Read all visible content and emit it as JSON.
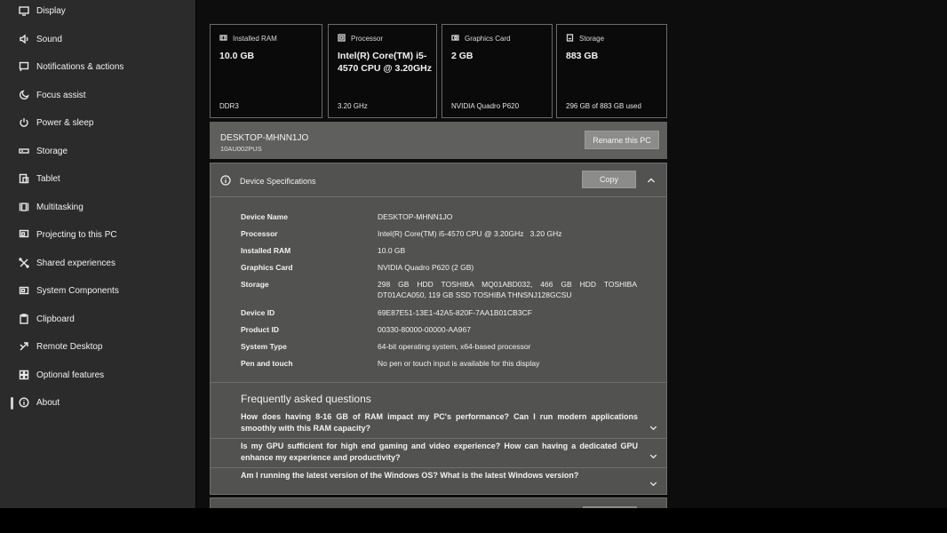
{
  "sidebar": {
    "items": [
      {
        "label": "Display",
        "icon": "monitor-icon"
      },
      {
        "label": "Sound",
        "icon": "speaker-icon"
      },
      {
        "label": "Notifications & actions",
        "icon": "notification-icon"
      },
      {
        "label": "Focus assist",
        "icon": "moon-icon"
      },
      {
        "label": "Power & sleep",
        "icon": "power-icon"
      },
      {
        "label": "Storage",
        "icon": "storage-icon"
      },
      {
        "label": "Tablet",
        "icon": "tablet-icon"
      },
      {
        "label": "Multitasking",
        "icon": "multitasking-icon"
      },
      {
        "label": "Projecting to this PC",
        "icon": "projecting-icon"
      },
      {
        "label": "Shared experiences",
        "icon": "shared-experiences-icon"
      },
      {
        "label": "System Components",
        "icon": "system-components-icon"
      },
      {
        "label": "Clipboard",
        "icon": "clipboard-icon"
      },
      {
        "label": "Remote Desktop",
        "icon": "remote-desktop-icon"
      },
      {
        "label": "Optional features",
        "icon": "optional-features-icon"
      },
      {
        "label": "About",
        "icon": "info-icon"
      }
    ],
    "active": "About"
  },
  "cards": [
    {
      "title": "Installed RAM",
      "value": "10.0 GB",
      "sub": "DDR3",
      "icon": "ram-icon"
    },
    {
      "title": "Processor",
      "value": "Intel(R) Core(TM) i5-4570 CPU @ 3.20GHz",
      "sub": "3.20 GHz",
      "icon": "processor-icon"
    },
    {
      "title": "Graphics Card",
      "value": "2 GB",
      "sub": "NVIDIA Quadro P620",
      "icon": "graphics-card-icon"
    },
    {
      "title": "Storage",
      "value": "883 GB",
      "sub": "296 GB of 883 GB used",
      "icon": "storage-icon"
    }
  ],
  "device": {
    "name": "DESKTOP-MHNN1JO",
    "model": "10AU002PUS",
    "rename_label": "Rename this PC"
  },
  "specs": {
    "title": "Device Specifications",
    "copy_label": "Copy",
    "rows": [
      {
        "key": "Device Name",
        "value": "DESKTOP-MHNN1JO"
      },
      {
        "key": "Processor",
        "value": "Intel(R) Core(TM) i5-4570 CPU @ 3.20GHz   3.20 GHz"
      },
      {
        "key": "Installed RAM",
        "value": "10.0 GB"
      },
      {
        "key": "Graphics Card",
        "value": "NVIDIA Quadro P620 (2 GB)"
      },
      {
        "key": "Storage",
        "value": "298 GB HDD TOSHIBA MQ01ABD032, 466 GB HDD TOSHIBA DT01ACA050, 119 GB SSD TOSHIBA THNSNJ128GCSU"
      },
      {
        "key": "Device ID",
        "value": "69E87E51-13E1-42A5-820F-7AA1B01CB3CF"
      },
      {
        "key": "Product ID",
        "value": "00330-80000-00000-AA967"
      },
      {
        "key": "System Type",
        "value": "64-bit operating system, x64-based processor"
      },
      {
        "key": "Pen and touch",
        "value": "No pen or touch input is available for this display"
      }
    ]
  },
  "faq": {
    "title": "Frequently asked questions",
    "items": [
      "How does having 8-16 GB of RAM impact my PC's performance? Can I run modern applications smoothly with this RAM capacity?",
      "Is my GPU sufficient for high end gaming and video experience? How can having a dedicated GPU enhance my experience and productivity?",
      "Am I running the latest version of the Windows OS? What is the latest Windows version?"
    ]
  }
}
